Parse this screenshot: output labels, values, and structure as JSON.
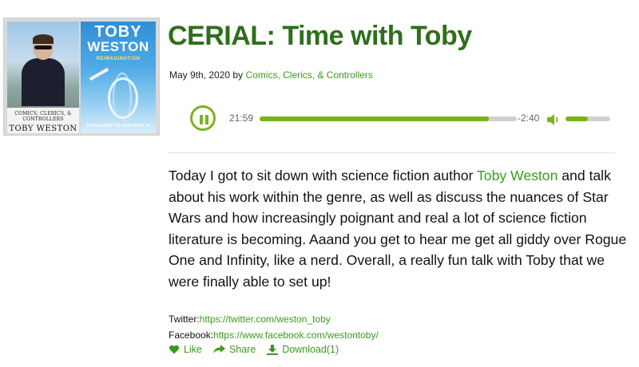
{
  "thumbnail": {
    "caption_small": "COMICS, CLERICS, & CONTROLLERS",
    "caption_name": "TOBY WESTON",
    "book_title_line1": "TOBY",
    "book_title_line2": "WESTON",
    "book_subtitle": "REIMAGINATION",
    "book_series": "SINGULARITY'S CHILDREN #4"
  },
  "episode": {
    "title": "CERIAL: Time with Toby",
    "date": "May 9th, 2020",
    "by": "by",
    "category": "Comics, Clerics, & Controllers"
  },
  "player": {
    "state_icon": "pause-icon",
    "current_time": "21:59",
    "remaining_time": "-2:40",
    "progress": 0.89,
    "volume": 0.5,
    "accent": "#7bb31e"
  },
  "description": {
    "part1": "Today I got to sit down with science fiction author ",
    "link_text": "Toby Weston",
    "part2": " and talk about his work within the genre, as well as discuss the nuances of Star Wars and how increasingly poignant and real a lot of science fiction literature is becoming. Aaand you get to hear me get all giddy over Rogue One and Infinity, like a nerd. Overall, a really fun talk with Toby that we were finally able to set up!"
  },
  "links": {
    "twitter_label": "Twitter:",
    "twitter_url": "https://twitter.com/weston_toby",
    "facebook_label": "Facebook:",
    "facebook_url": "https://www.facebook.com/westontoby/"
  },
  "actions": {
    "like": "Like",
    "share": "Share",
    "download": "Download(1)"
  }
}
